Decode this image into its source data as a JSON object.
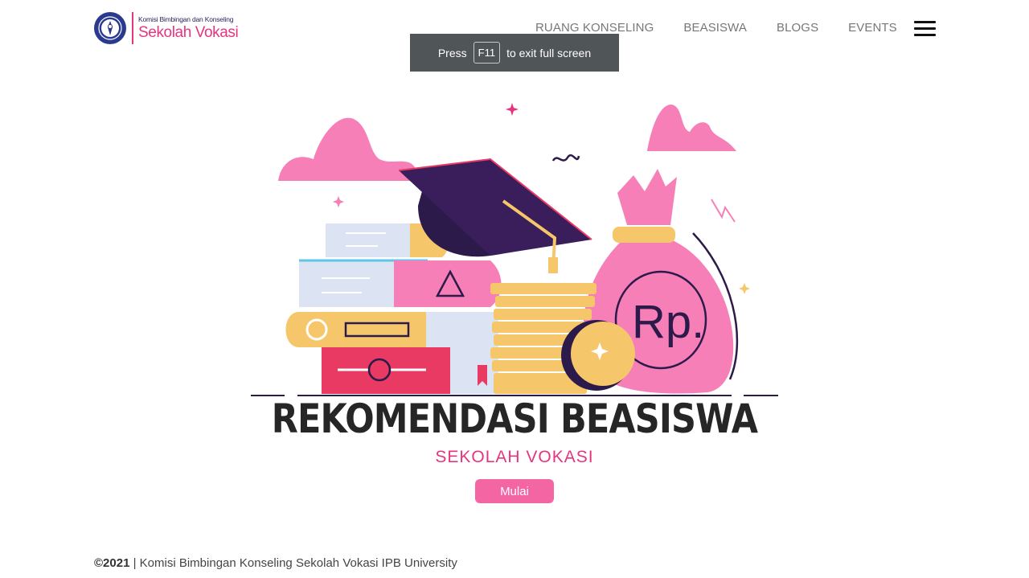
{
  "header": {
    "logo_small": "Komisi Bimbingan dan Konseling",
    "logo_big": "Sekolah Vokasi",
    "nav": [
      "RUANG KONSELING",
      "BEASISWA",
      "BLOGS",
      "EVENTS"
    ]
  },
  "fullscreen_notice": {
    "before": "Press",
    "key": "F11",
    "after": "to exit full screen"
  },
  "hero": {
    "title": "REKOMENDASI BEASISWA",
    "subtitle": "SEKOLAH VOKASI",
    "button": "Mulai",
    "currency_mark": "Rp."
  },
  "footer": {
    "copyright": "©2021",
    "separator": "|",
    "text": "Komisi Bimbingan Konseling Sekolah Vokasi IPB University"
  },
  "colors": {
    "brand_pink": "#e5357f",
    "button_pink": "#f465a4",
    "navy": "#2a2560"
  }
}
